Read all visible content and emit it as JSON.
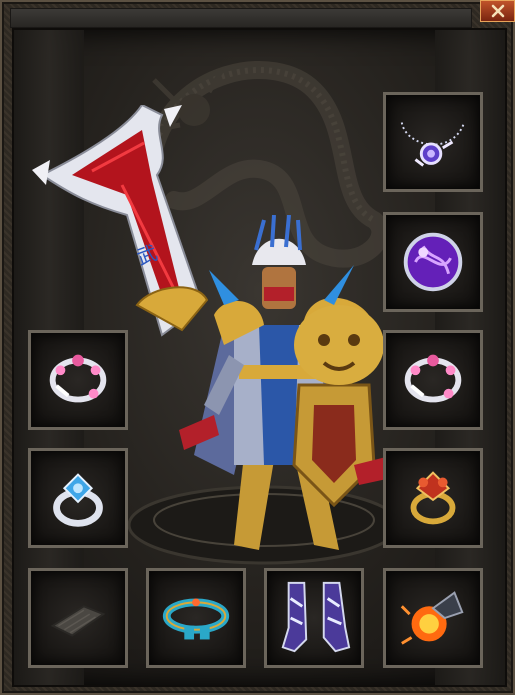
{
  "window": {
    "close_icon": "close-x-icon"
  },
  "equipment": {
    "slots": [
      {
        "id": "necklace",
        "icon": "necklace-icon",
        "equipped": true
      },
      {
        "id": "helmet-orb",
        "icon": "purple-orb-icon",
        "equipped": true
      },
      {
        "id": "bracelet-left",
        "icon": "bracelet-icon",
        "equipped": true
      },
      {
        "id": "bracelet-right",
        "icon": "bracelet-icon",
        "equipped": true
      },
      {
        "id": "ring-left",
        "icon": "blue-gem-ring-icon",
        "equipped": true
      },
      {
        "id": "ring-right",
        "icon": "red-gem-ring-icon",
        "equipped": true
      },
      {
        "id": "amulet",
        "icon": "empty-slot-icon",
        "equipped": false
      },
      {
        "id": "belt",
        "icon": "belt-icon",
        "equipped": true
      },
      {
        "id": "boots",
        "icon": "boots-icon",
        "equipped": true
      },
      {
        "id": "gem",
        "icon": "fire-gem-icon",
        "equipped": true
      }
    ]
  },
  "character": {
    "weapon_icon": "great-sword-icon",
    "armor_icon": "golden-armor-icon"
  },
  "colors": {
    "slot_border": "#6b655b",
    "gold": "#d8a93a",
    "close_button": "#a83f1c"
  }
}
